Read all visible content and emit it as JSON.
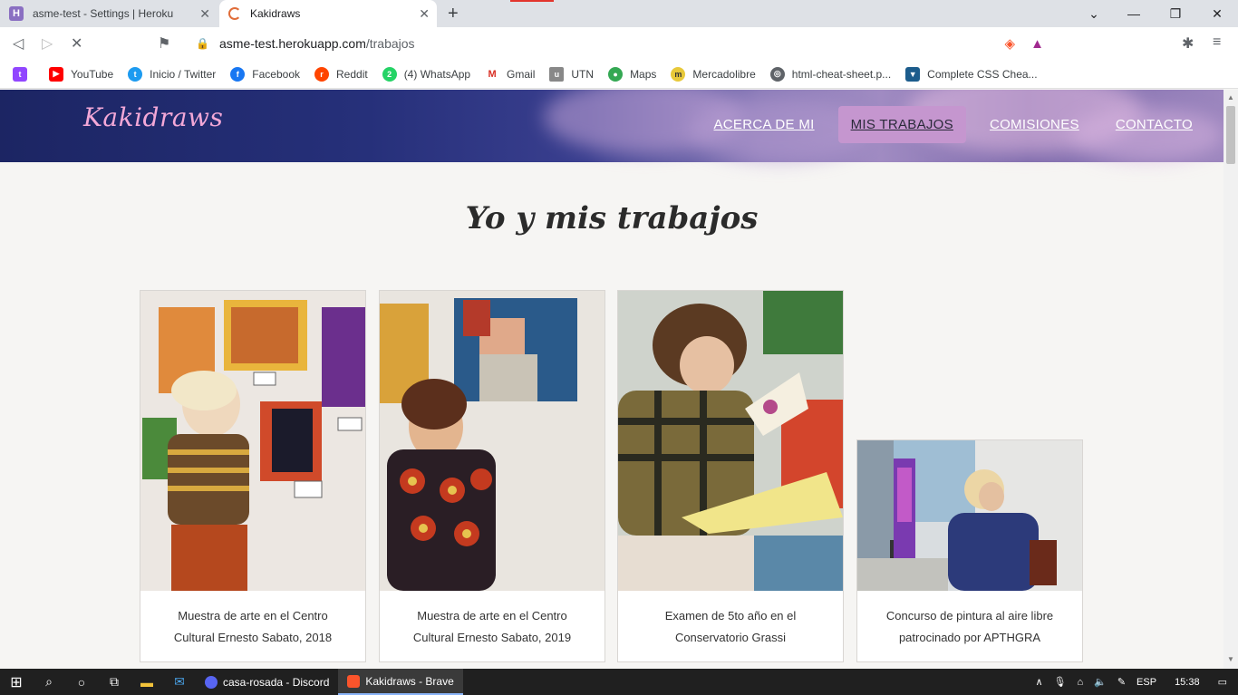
{
  "browser": {
    "tabs": [
      {
        "title": "asme-test - Settings | Heroku",
        "favicon": "heroku-icon",
        "color": "#8a6fc2"
      },
      {
        "title": "Kakidraws",
        "favicon": "loading-icon",
        "color": "#e06d3a"
      }
    ],
    "url_domain": "asme-test.herokuapp.com",
    "url_path": "/trabajos"
  },
  "bookmarks": [
    {
      "label": "",
      "icon": "twitch-icon",
      "color": "#9146ff"
    },
    {
      "label": "YouTube",
      "icon": "youtube-icon",
      "color": "#ff0000"
    },
    {
      "label": "Inicio / Twitter",
      "icon": "twitter-icon",
      "color": "#1d9bf0"
    },
    {
      "label": "Facebook",
      "icon": "facebook-icon",
      "color": "#1877f2"
    },
    {
      "label": "Reddit",
      "icon": "reddit-icon",
      "color": "#ff4500"
    },
    {
      "label": "(4) WhatsApp",
      "icon": "whatsapp-icon",
      "color": "#25d366"
    },
    {
      "label": "Gmail",
      "icon": "gmail-icon",
      "color": "#d93025"
    },
    {
      "label": "UTN",
      "icon": "utn-icon",
      "color": "#888888"
    },
    {
      "label": "Maps",
      "icon": "maps-icon",
      "color": "#34a853"
    },
    {
      "label": "Mercadolibre",
      "icon": "mercadolibre-icon",
      "color": "#e8c93a"
    },
    {
      "label": "html-cheat-sheet.p...",
      "icon": "globe-icon",
      "color": "#5f6368"
    },
    {
      "label": "Complete CSS Chea...",
      "icon": "shield-icon",
      "color": "#1c5c8c"
    }
  ],
  "site": {
    "logo": "Kakidraws",
    "nav": [
      {
        "label": "ACERCA DE MI",
        "active": false
      },
      {
        "label": "MIS TRABAJOS",
        "active": true
      },
      {
        "label": "COMISIONES",
        "active": false
      },
      {
        "label": "CONTACTO",
        "active": false
      }
    ],
    "title": "Yo y mis trabajos",
    "cards": [
      {
        "caption": "Muestra de arte en el Centro Cultural Ernesto Sabato, 2018"
      },
      {
        "caption": "Muestra de arte en el Centro Cultural Ernesto Sabato, 2019"
      },
      {
        "caption": "Examen de 5to año en el Conservatorio Grassi"
      },
      {
        "caption": "Concurso de pintura al aire libre patrocinado por APTHGRA"
      }
    ]
  },
  "taskbar": {
    "apps": [
      {
        "label": "casa-rosada - Discord",
        "icon": "discord-icon",
        "active": false
      },
      {
        "label": "Kakidraws - Brave",
        "icon": "brave-icon",
        "active": true
      }
    ],
    "language": "ESP",
    "time": "15:38"
  }
}
